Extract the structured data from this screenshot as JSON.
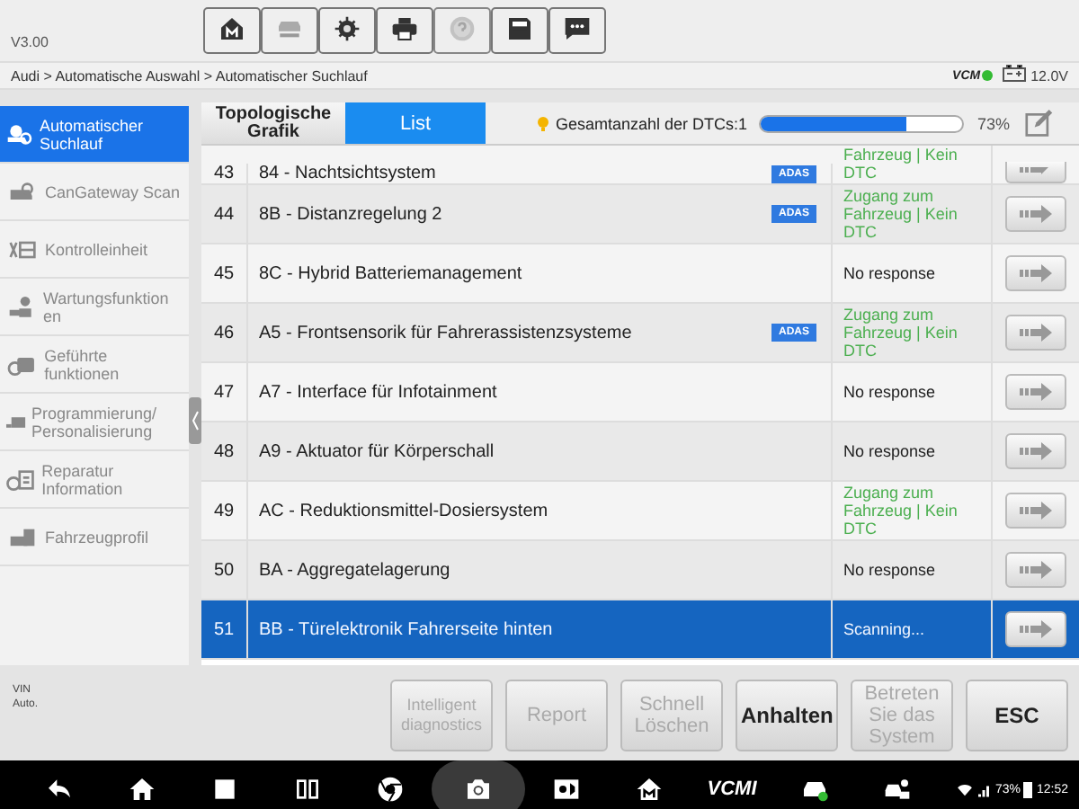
{
  "version": "V3.00",
  "toolbar": [
    {
      "kind": "home",
      "disabled": false
    },
    {
      "kind": "lift",
      "disabled": false
    },
    {
      "kind": "settings",
      "disabled": false
    },
    {
      "kind": "print",
      "disabled": false
    },
    {
      "kind": "help",
      "disabled": true
    },
    {
      "kind": "save",
      "disabled": false
    },
    {
      "kind": "chat",
      "disabled": false
    }
  ],
  "breadcrumb": "Audi > Automatische Auswahl > Automatischer Suchlauf",
  "vci": {
    "label": "VCM",
    "voltage": "12.0V"
  },
  "sidebar": [
    {
      "label": "Automatischer Suchlauf",
      "selected": true
    },
    {
      "label": "CanGateway Scan",
      "selected": false
    },
    {
      "label": "Kontrolleinheit",
      "selected": false
    },
    {
      "label": "Wartungsfunktion en",
      "selected": false
    },
    {
      "label": "Geführte funktionen",
      "selected": false
    },
    {
      "label": "Programmierung/ Personalisierung",
      "selected": false
    },
    {
      "label": "Reparatur Information",
      "selected": false
    },
    {
      "label": "Fahrzeugprofil",
      "selected": false
    }
  ],
  "tabs": [
    {
      "label": "Topologische Grafik",
      "selected": false
    },
    {
      "label": "List",
      "selected": true
    }
  ],
  "dtc_total": "Gesamtanzahl der DTCs:1",
  "progress": {
    "level": 0.73,
    "reading": "73%"
  },
  "rows": [
    {
      "no": "43",
      "name": "84 - Nachtsichtsystem",
      "adas": "ADAS",
      "status": "Fahrzeug | Kein DTC",
      "kind": "ok",
      "selected": false,
      "partial": true
    },
    {
      "no": "44",
      "name": "8B - Distanzregelung 2",
      "adas": "ADAS",
      "status": "Zugang zum Fahrzeug | Kein DTC",
      "kind": "ok",
      "selected": false
    },
    {
      "no": "45",
      "name": "8C - Hybrid Batteriemanagement",
      "status": "No response",
      "kind": "none",
      "selected": false
    },
    {
      "no": "46",
      "name": "A5 - Frontsensorik für Fahrerassistenzsysteme",
      "adas": "ADAS",
      "status": "Zugang zum Fahrzeug | Kein DTC",
      "kind": "ok",
      "selected": false
    },
    {
      "no": "47",
      "name": "A7 - Interface für Infotainment",
      "status": "No response",
      "kind": "none",
      "selected": false
    },
    {
      "no": "48",
      "name": "A9 - Aktuator für Körperschall",
      "status": "No response",
      "kind": "none",
      "selected": false
    },
    {
      "no": "49",
      "name": "AC - Reduktionsmittel-Dosiersystem",
      "status": "Zugang zum Fahrzeug | Kein DTC",
      "kind": "ok",
      "selected": false
    },
    {
      "no": "50",
      "name": "BA - Aggregatelagerung",
      "status": "No response",
      "kind": "none",
      "selected": false
    },
    {
      "no": "51",
      "name": "BB - Türelektronik Fahrerseite hinten",
      "status": "Scanning...",
      "kind": "scanning",
      "selected": true
    }
  ],
  "vehicle_info": [
    "VIN",
    "Auto."
  ],
  "buttons": [
    {
      "label": "Intelligent diagnostics",
      "disabled": true,
      "small": true
    },
    {
      "label": "Report",
      "disabled": true
    },
    {
      "label": "Schnell Löschen",
      "disabled": true
    },
    {
      "label": "Anhalten",
      "disabled": false
    },
    {
      "label": "Betreten Sie das System",
      "disabled": true
    },
    {
      "label": "ESC",
      "disabled": false
    }
  ],
  "navbar": [
    {
      "kind": "back"
    },
    {
      "kind": "home"
    },
    {
      "kind": "recent"
    },
    {
      "kind": "split"
    },
    {
      "kind": "browser"
    },
    {
      "kind": "camera",
      "selected": true
    },
    {
      "kind": "brightness"
    },
    {
      "kind": "mhome"
    },
    {
      "kind": "vcmi",
      "label": "VCMI"
    },
    {
      "kind": "car"
    },
    {
      "kind": "person"
    }
  ],
  "status": {
    "battery": "73%",
    "time": "12:52"
  }
}
